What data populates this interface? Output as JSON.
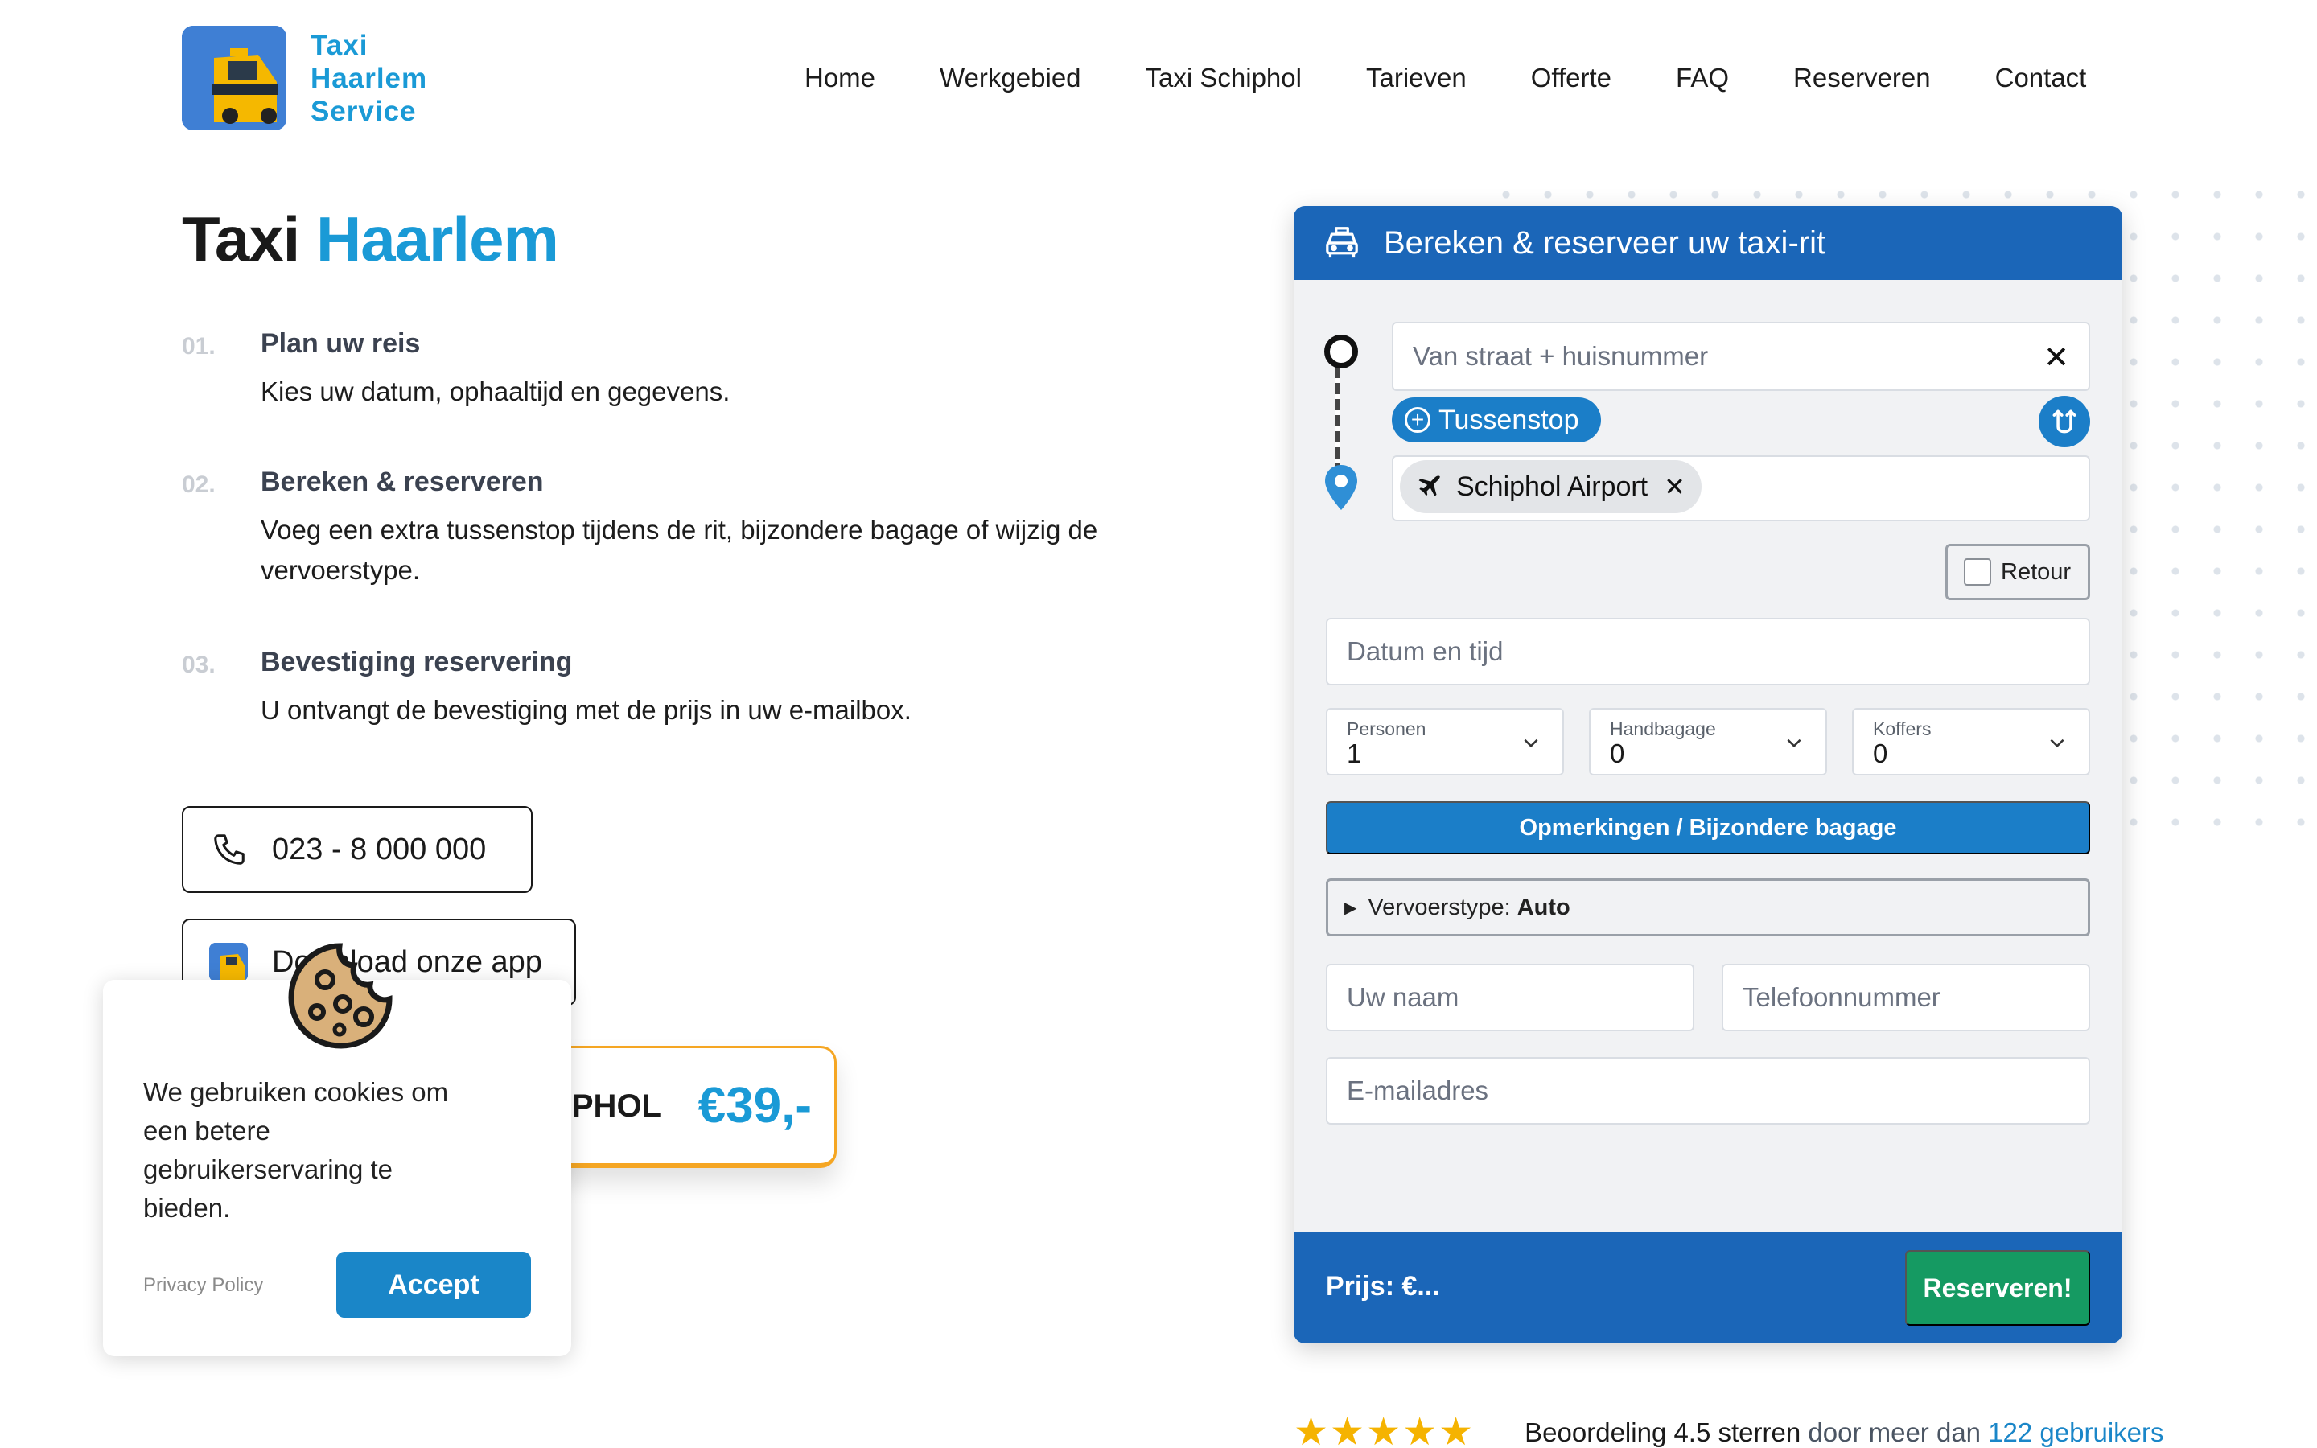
{
  "brand": {
    "line1": "Taxi",
    "line2": "Haarlem",
    "line3": "Service"
  },
  "nav": [
    "Home",
    "Werkgebied",
    "Taxi Schiphol",
    "Tarieven",
    "Offerte",
    "FAQ",
    "Reserveren",
    "Contact"
  ],
  "hero": {
    "title_main": "Taxi",
    "title_accent": "Haarlem"
  },
  "steps": [
    {
      "num": "01.",
      "title": "Plan uw reis",
      "desc": "Kies uw datum, ophaaltijd en gegevens."
    },
    {
      "num": "02.",
      "title": "Bereken & reserveren",
      "desc": "Voeg een extra tussenstop tijdens de rit, bijzondere bagage of wijzig de vervoerstype."
    },
    {
      "num": "03.",
      "title": "Bevestiging reservering",
      "desc": "U ontvangt de bevestiging met de prijs in uw e-mailbox."
    }
  ],
  "phone": "023 - 8 000 000",
  "app_button": "Download onze app",
  "price_tag": {
    "route": "PHOL",
    "amount": "€39,-"
  },
  "cookie": {
    "text": "We gebruiken cookies om een betere gebruikerservaring te bieden.",
    "privacy": "Privacy Policy",
    "accept": "Accept"
  },
  "form": {
    "title": "Bereken & reserveer uw taxi-rit",
    "from_placeholder": "Van straat + huisnummer",
    "stop_button": "Tussenstop",
    "destination_chip": "Schiphol Airport",
    "retour": "Retour",
    "datetime_placeholder": "Datum en tijd",
    "selects": [
      {
        "label": "Personen",
        "value": "1"
      },
      {
        "label": "Handbagage",
        "value": "0"
      },
      {
        "label": "Koffers",
        "value": "0"
      }
    ],
    "remarks_button": "Opmerkingen / Bijzondere bagage",
    "vervoer_label": "Vervoerstype:",
    "vervoer_value": "Auto",
    "name_placeholder": "Uw naam",
    "phone_placeholder": "Telefoonnummer",
    "email_placeholder": "E-mailadres",
    "price_label": "Prijs: €...",
    "reserve_button": "Reserveren!"
  },
  "rating": {
    "prefix": "Beoordeling 4.5 sterren",
    "middle": "door meer dan",
    "link": "122 gebruikers",
    "stars": 4.5
  },
  "colors": {
    "accent": "#1a9ad6",
    "primary": "#1b66b8",
    "button": "#1b7ec8",
    "success": "#159a62",
    "price_border": "#f5a623"
  }
}
